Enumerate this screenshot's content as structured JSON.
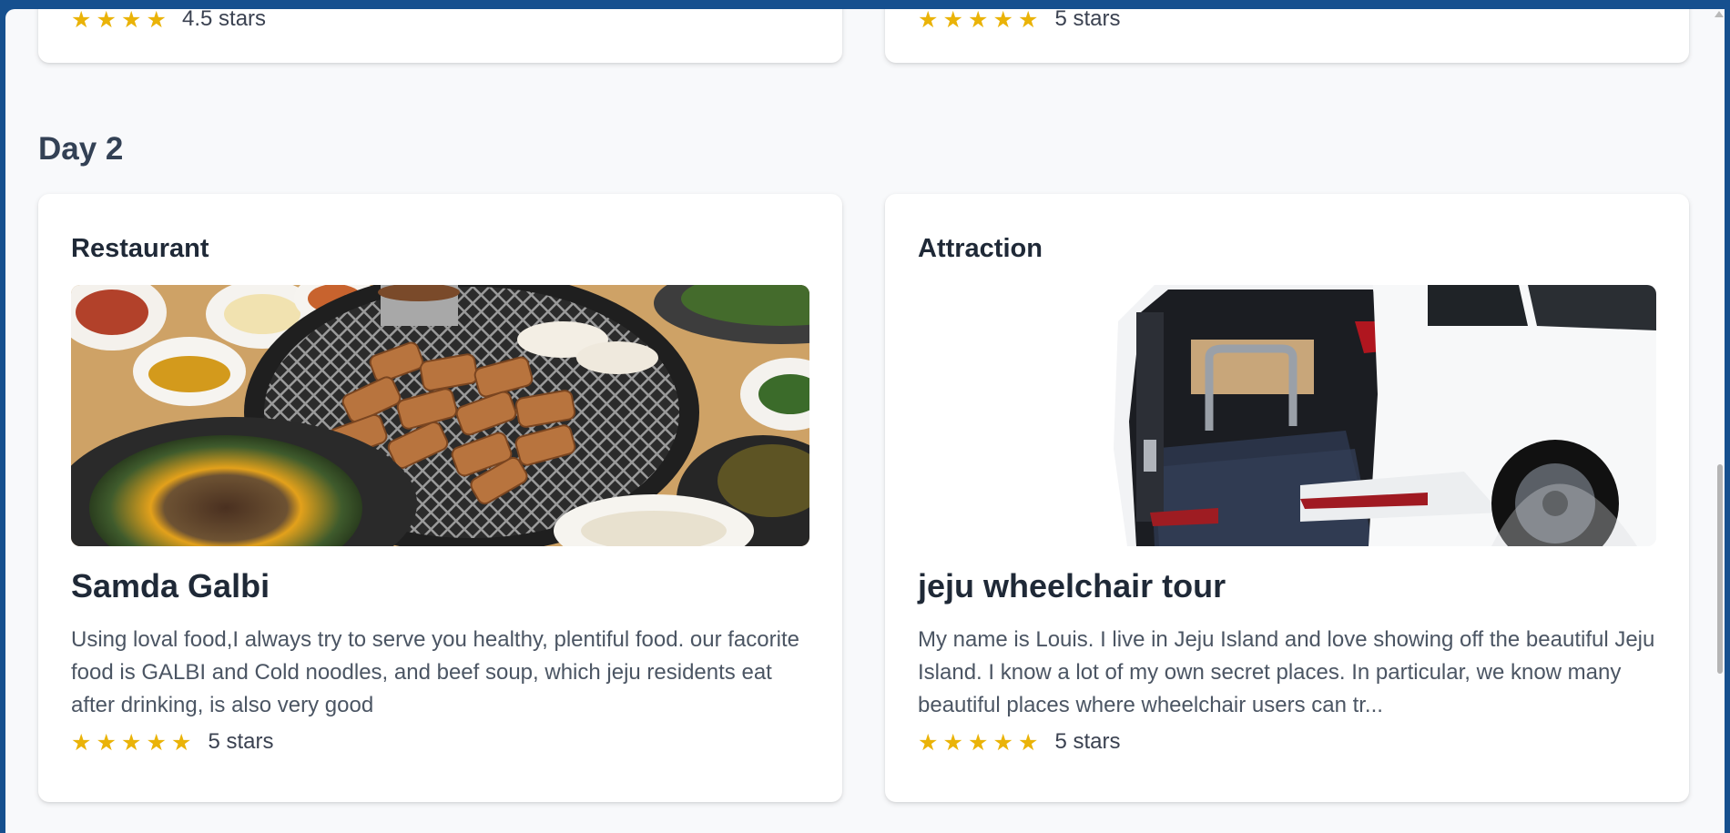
{
  "page": {
    "day_heading": "Day 2"
  },
  "top_cards": [
    {
      "stars": "★★★★",
      "rating_label": "4.5 stars"
    },
    {
      "stars": "★★★★★",
      "rating_label": "5 stars"
    }
  ],
  "day2_cards": [
    {
      "category": "Restaurant",
      "title": "Samda Galbi",
      "description": "Using loval food,I always try to serve you healthy, plentiful food. our facorite food is GALBI and Cold noodles, and beef soup, which jeju residents eat after drinking, is also very good",
      "stars": "★★★★★",
      "rating_label": "5 stars",
      "image_alt": "grilled-pork-galbi-photo"
    },
    {
      "category": "Attraction",
      "title": "jeju wheelchair tour",
      "description": "My name is Louis. I live in Jeju Island and love showing off the beautiful Jeju Island. I know a lot of my own secret places. In particular, we know many beautiful places where wheelchair users can tr...",
      "stars": "★★★★★",
      "rating_label": "5 stars",
      "image_alt": "wheelchair-accessible-van-photo"
    }
  ],
  "colors": {
    "star": "#eab308",
    "frame": "#16508f",
    "background": "#f8f9fb"
  }
}
